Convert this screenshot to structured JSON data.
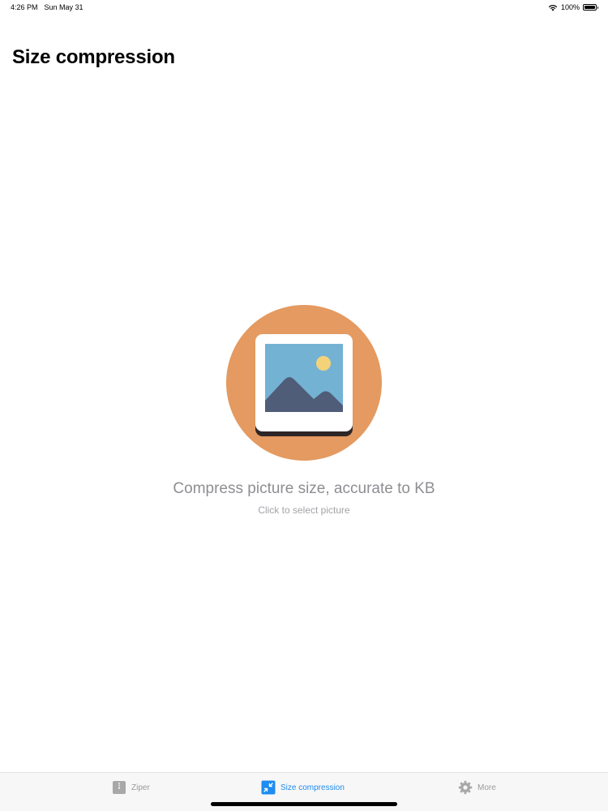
{
  "status_bar": {
    "time": "4:26 PM",
    "date": "Sun May 31",
    "battery": "100%",
    "icons": [
      "wifi-icon",
      "battery-icon"
    ]
  },
  "page": {
    "title": "Size compression"
  },
  "picker": {
    "illustration": "picture-icon",
    "title": "Compress picture size, accurate to KB",
    "subtitle": "Click to select picture"
  },
  "tab_bar": {
    "tabs": [
      {
        "label": "Ziper",
        "icon": "zip-file-icon",
        "active": false
      },
      {
        "label": "Size compression",
        "icon": "compress-icon",
        "active": true
      },
      {
        "label": "More",
        "icon": "gear-icon",
        "active": false
      }
    ]
  },
  "colors": {
    "accent": "#1e8cf0",
    "illustration_circle": "#e49a60",
    "sky": "#74b2d4",
    "mountains": "#4f5d78",
    "sun": "#f4d27a",
    "muted_text": "#8e8e93"
  }
}
